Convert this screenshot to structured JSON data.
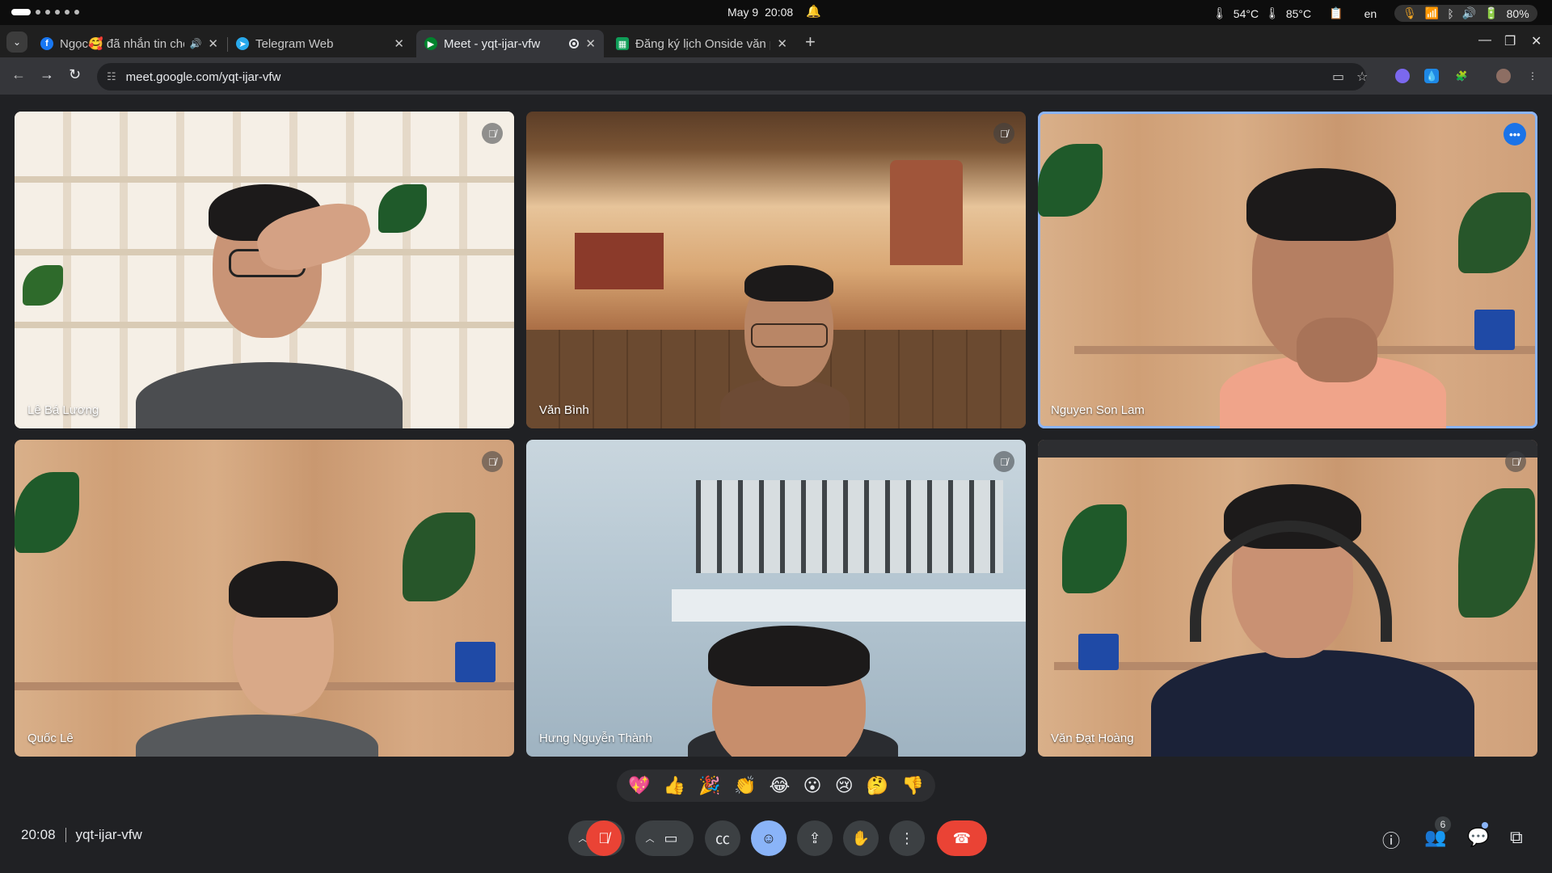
{
  "system_bar": {
    "date": "May 9",
    "time": "20:08",
    "temp_cpu": "54°C",
    "temp_gpu": "85°C",
    "lang": "en",
    "battery": "80%"
  },
  "tabs": [
    {
      "title": "Ngọc🥰 đã nhắn tin cho bạn",
      "favicon": "facebook-icon",
      "color": "#1877f2",
      "has_sound": true
    },
    {
      "title": "Telegram Web",
      "favicon": "telegram-icon",
      "color": "#29a9eb"
    },
    {
      "title": "Meet - yqt-ijar-vfw",
      "favicon": "meet-icon",
      "color": "#00832d",
      "active": true,
      "recording": true
    },
    {
      "title": "Đăng ký lịch Onside văn phòng",
      "favicon": "sheets-icon",
      "color": "#0f9d58"
    }
  ],
  "address_bar": {
    "url": "meet.google.com/yqt-ijar-vfw"
  },
  "participants": [
    {
      "name": "Lê Bá Lương",
      "muted": true
    },
    {
      "name": "Văn Bình",
      "muted": true
    },
    {
      "name": "Nguyen Son Lam",
      "muted": false,
      "speaking": true
    },
    {
      "name": "Quốc Lê",
      "muted": true
    },
    {
      "name": "Hưng Nguyễn Thành",
      "muted": true
    },
    {
      "name": "Văn Đạt Hoàng",
      "muted": true
    }
  ],
  "reactions": [
    "💖",
    "👍",
    "🎉",
    "👏",
    "😂",
    "😮",
    "😢",
    "🤔",
    "👎"
  ],
  "meeting": {
    "time": "20:08",
    "code": "yqt-ijar-vfw",
    "people_count": "6"
  },
  "colors": {
    "accent": "#8ab4f8",
    "end_call": "#ea4335",
    "background": "#202124",
    "control": "#3c4043"
  }
}
